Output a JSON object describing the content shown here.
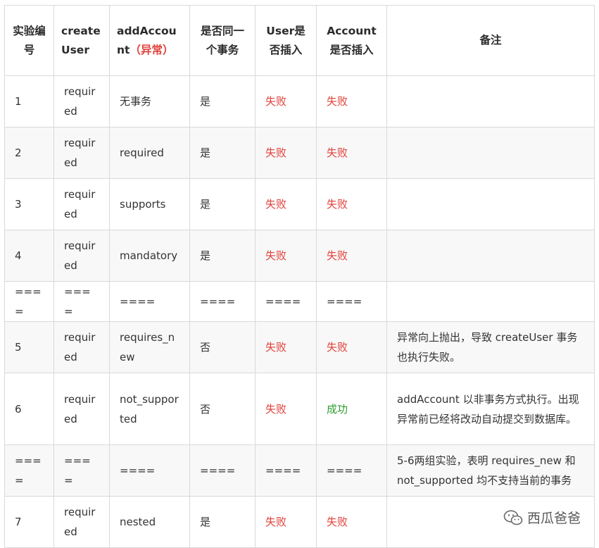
{
  "headers": [
    {
      "name": "header-experiment-no",
      "text": "实验编号"
    },
    {
      "name": "header-create-user",
      "text": "createUser"
    },
    {
      "name": "header-add-account",
      "text": "addAccount",
      "extra": "（异常）"
    },
    {
      "name": "header-same-tx",
      "text": "是否同一个事务"
    },
    {
      "name": "header-user-inserted",
      "text": "User是否插入"
    },
    {
      "name": "header-account-inserted",
      "text": "Account是否插入"
    },
    {
      "name": "header-remark",
      "text": "备注"
    }
  ],
  "rows": [
    {
      "no": "1",
      "create_user": "required",
      "add_account": "无事务",
      "same": "是",
      "user": "失败",
      "account": "失败",
      "remark": ""
    },
    {
      "no": "2",
      "create_user": "required",
      "add_account": "required",
      "same": "是",
      "user": "失败",
      "account": "失败",
      "remark": ""
    },
    {
      "no": "3",
      "create_user": "required",
      "add_account": "supports",
      "same": "是",
      "user": "失败",
      "account": "失败",
      "remark": ""
    },
    {
      "no": "4",
      "create_user": "required",
      "add_account": "mandatory",
      "same": "是",
      "user": "失败",
      "account": "失败",
      "remark": ""
    },
    {
      "no": "====",
      "create_user": "====",
      "add_account": "====",
      "same": "====",
      "user": "====",
      "account": "====",
      "remark": ""
    },
    {
      "no": "5",
      "create_user": "required",
      "add_account": "requires_new",
      "same": "否",
      "user": "失败",
      "account": "失败",
      "remark": "异常向上抛出，导致 createUser 事务也执行失败。"
    },
    {
      "no": "6",
      "create_user": "required",
      "add_account": "not_supported",
      "same": "否",
      "user": "失败",
      "account": "成功",
      "remark": "addAccount 以非事务方式执行。出现异常前已经将改动自动提交到数据库。"
    },
    {
      "no": "====",
      "create_user": "====",
      "add_account": "====",
      "same": "====",
      "user": "====",
      "account": "====",
      "remark": "5-6两组实验，表明 requires_new 和 not_supported 均不支持当前的事务"
    },
    {
      "no": "7",
      "create_user": "required",
      "add_account": "nested",
      "same": "是",
      "user": "失败",
      "account": "失败",
      "remark": ""
    }
  ],
  "colors": {
    "fail": "#e0413a",
    "success": "#2e9b2e"
  },
  "watermark": {
    "icon": "wechat-icon",
    "text": "西瓜爸爸"
  }
}
